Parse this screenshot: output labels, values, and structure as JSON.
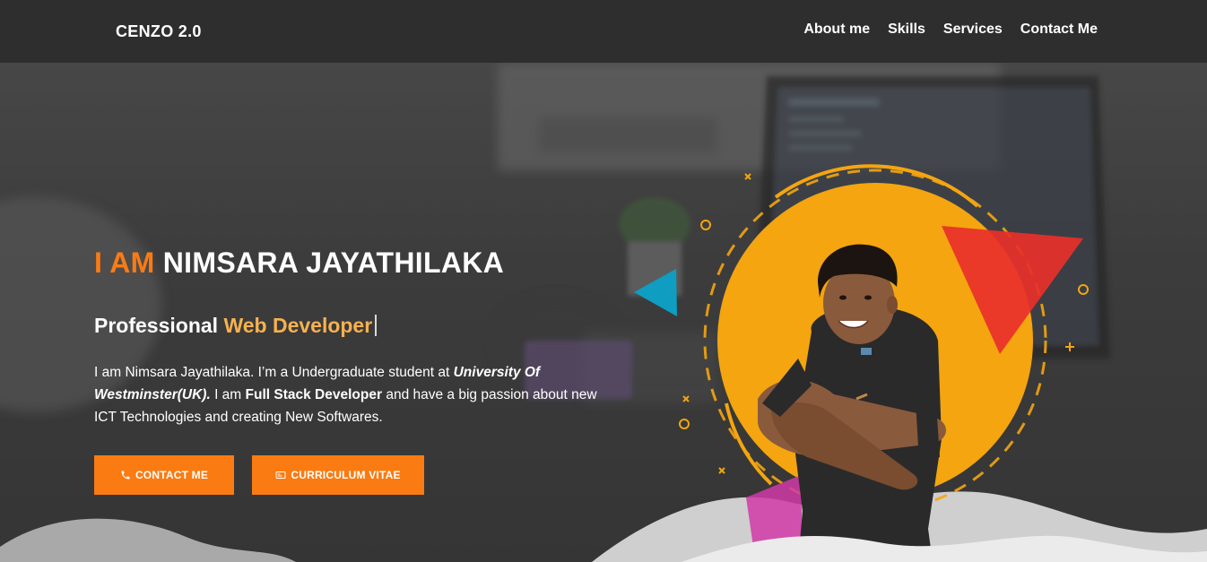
{
  "brand": {
    "logo": "CENZO 2.0"
  },
  "nav": {
    "items": [
      {
        "label": "About me"
      },
      {
        "label": "Skills"
      },
      {
        "label": "Services"
      },
      {
        "label": "Contact Me"
      }
    ]
  },
  "hero": {
    "prefix": "I AM",
    "name": "NIMSARA JAYATHILAKA",
    "role_prefix": "Professional",
    "role_highlight": "Web Developer",
    "bio": {
      "p1": "I am Nimsara Jayathilaka. I’m a Undergraduate student at ",
      "university": "University Of Westminster(UK).",
      "p2": " I am ",
      "stack": "Full Stack Developer",
      "p3": " and have a big passion about new ICT Technologies and creating New Softwares."
    },
    "buttons": {
      "contact": "CONTACT ME",
      "cv": "CURRICULUM VITAE"
    }
  },
  "icons": {
    "contact_button": "phone-icon",
    "cv_button": "id-card-icon"
  },
  "colors": {
    "accent": "#fa7b14",
    "accent_light": "#f7b150",
    "portrait_circle": "#f4a50f",
    "triangle_red": "#e8302a",
    "triangle_teal": "#0f9ec1",
    "triangle_pink": "#d13aa8",
    "navbar": "#2e2e2e"
  }
}
